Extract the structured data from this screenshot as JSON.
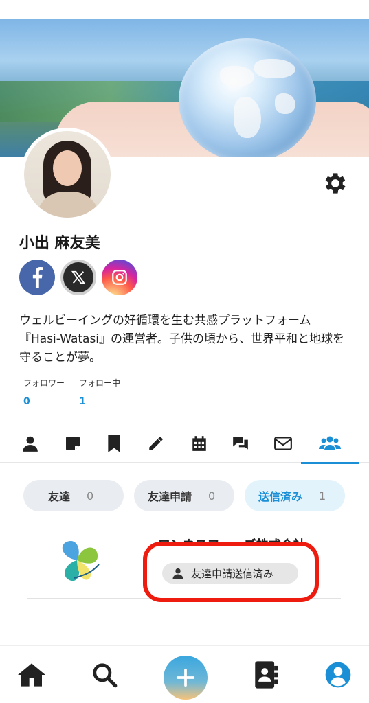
{
  "profile": {
    "name": "小出 麻友美",
    "bio": "ウェルビーイングの好循環を生む共感プラットフォーム『Hasi-Watasi』の運営者。子供の頃から、世界平和と地球を守ることが夢。",
    "followers_label": "フォロワー",
    "followers_count": "0",
    "following_label": "フォロー中",
    "following_count": "1"
  },
  "social": [
    "facebook-icon",
    "x-icon",
    "instagram-icon"
  ],
  "tabs": [
    "user-icon",
    "note-icon",
    "bookmark-icon",
    "pencil-icon",
    "calendar-icon",
    "chat-icon",
    "mail-icon",
    "friends-icon"
  ],
  "active_tab": "friends-icon",
  "friend_filters": [
    {
      "label": "友達",
      "count": "0"
    },
    {
      "label": "友達申請",
      "count": "0"
    },
    {
      "label": "送信済み",
      "count": "1"
    }
  ],
  "request_card": {
    "org_name": "ワンネスフェーズ株式会社",
    "status_label": "友達申請送信済み"
  },
  "bottom_nav": [
    "home-icon",
    "search-icon",
    "add-icon",
    "contacts-icon",
    "profile-icon"
  ],
  "colors": {
    "accent": "#1a8fd6",
    "highlight": "#ee1c0f"
  }
}
